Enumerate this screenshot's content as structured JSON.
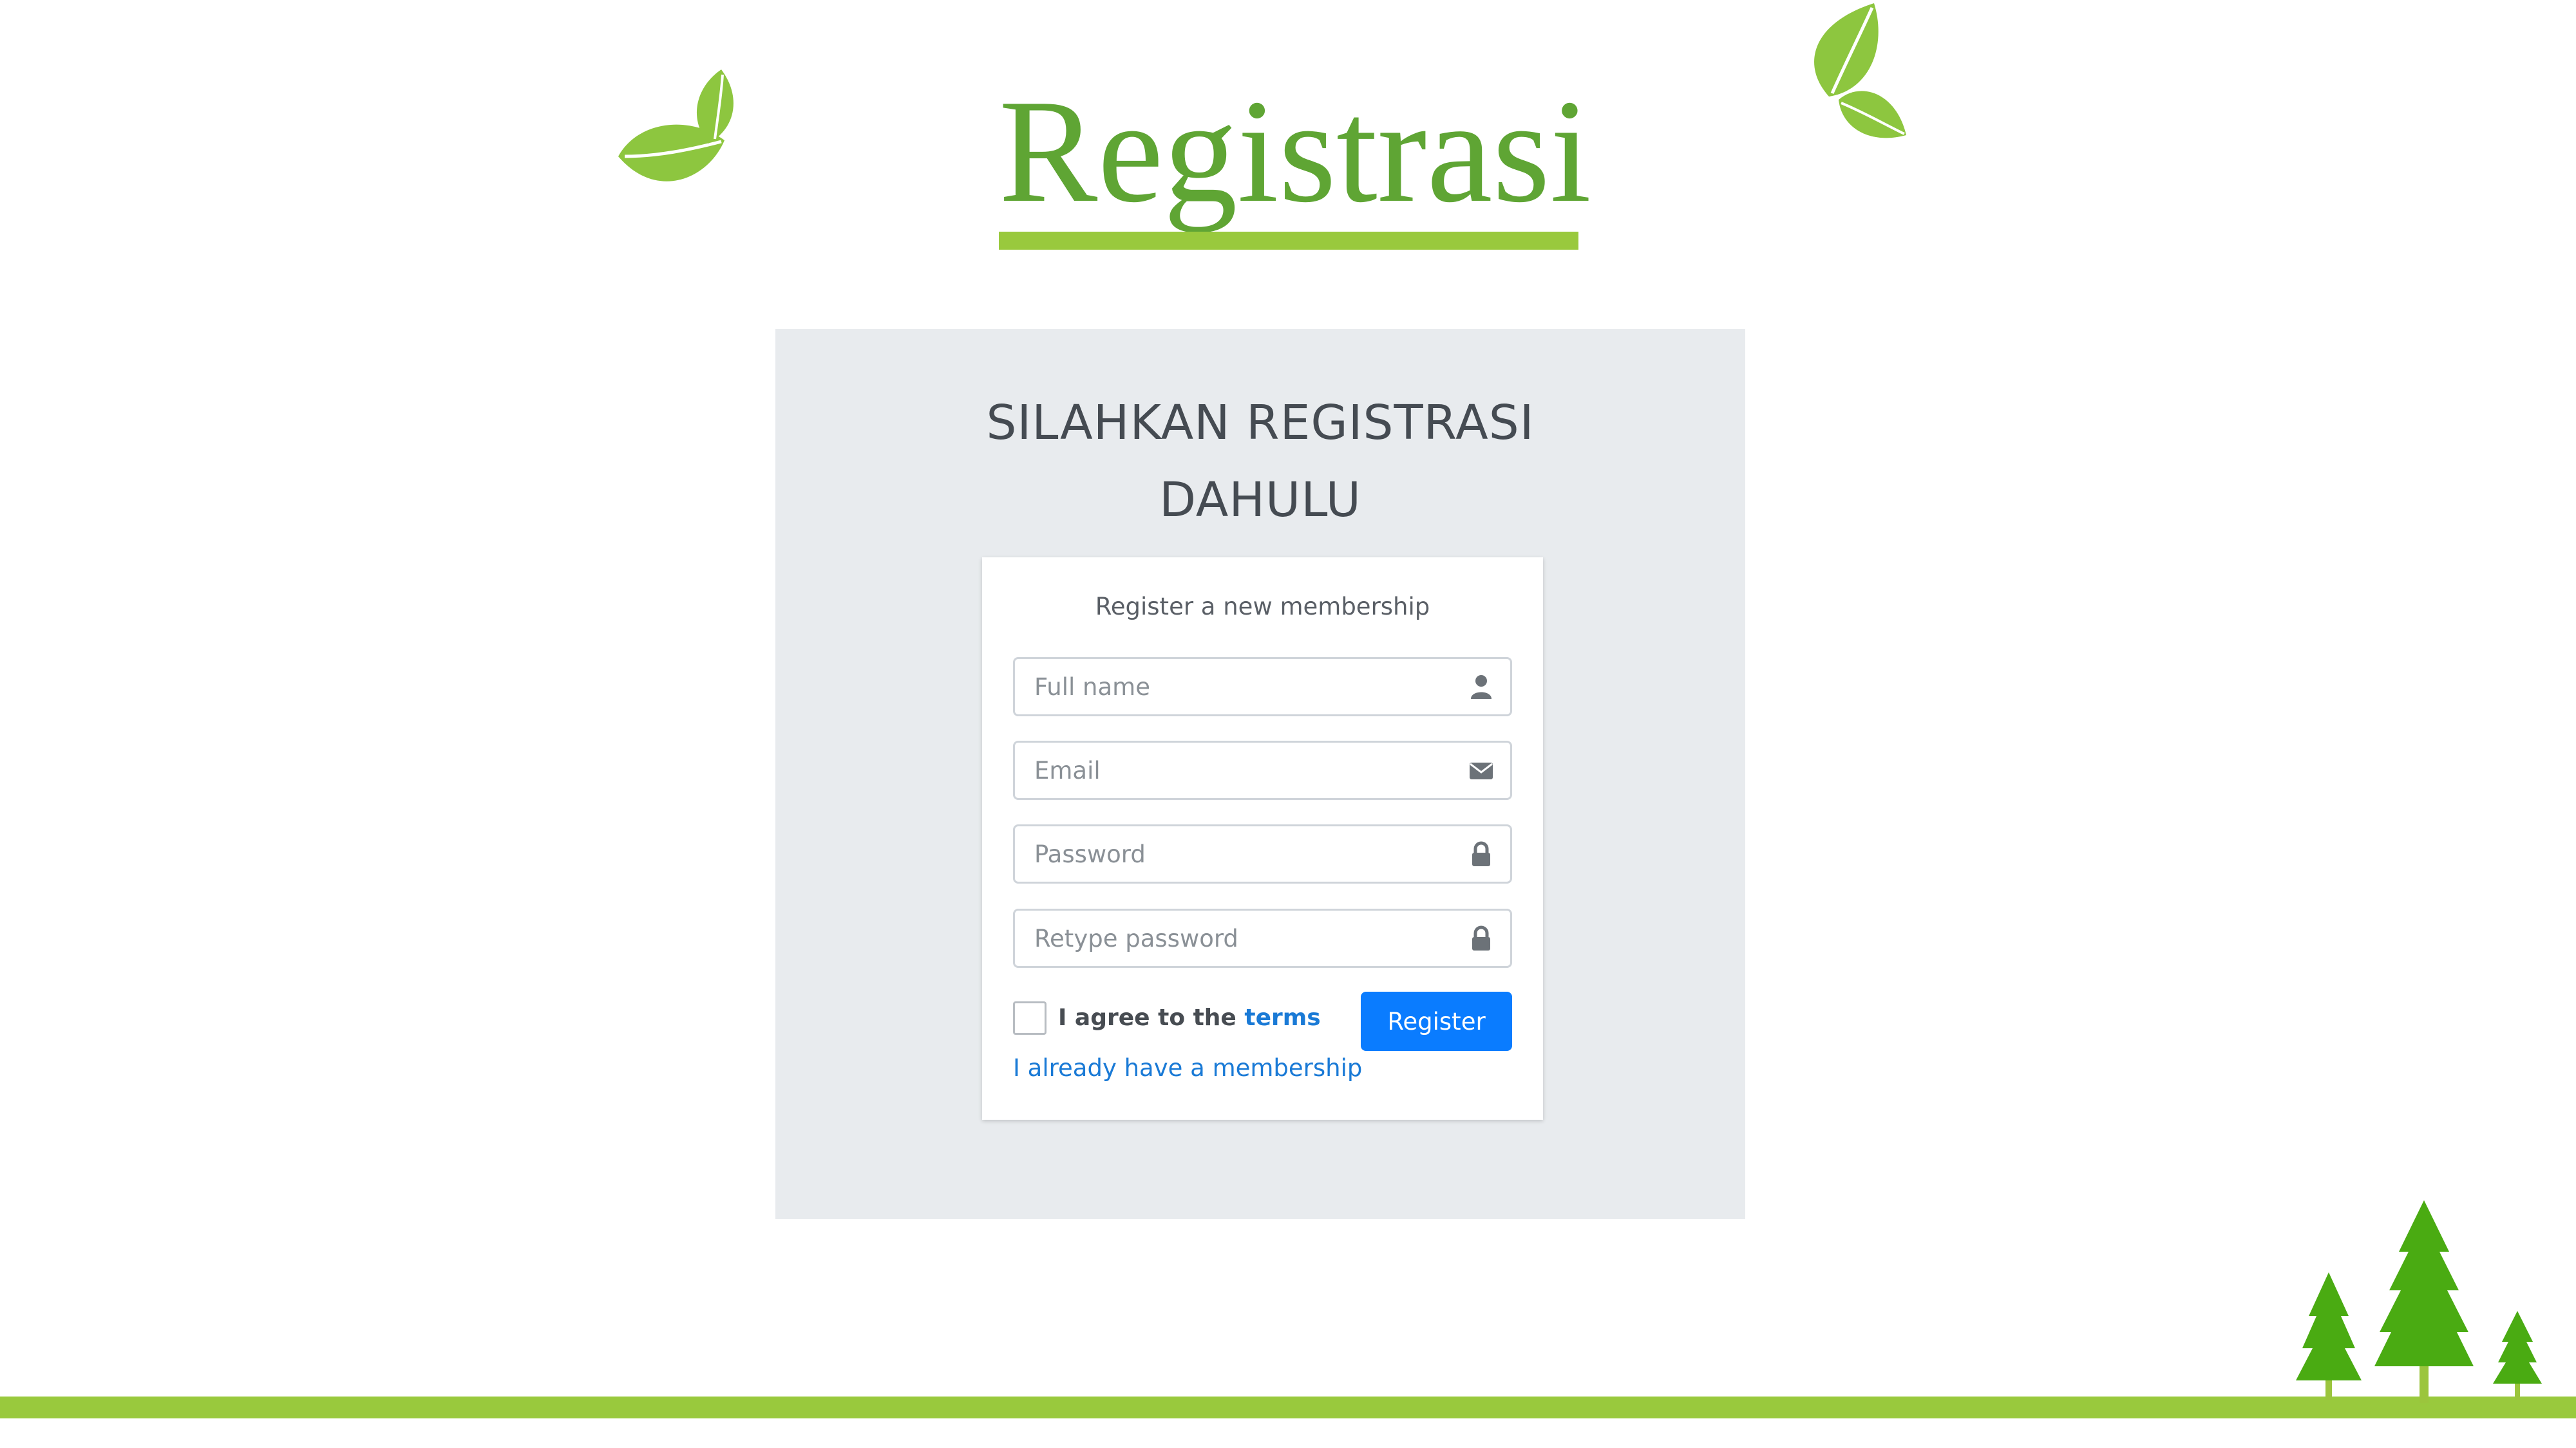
{
  "title": "Registrasi",
  "panel": {
    "heading_line1": "SILAHKAN REGISTRASI",
    "heading_line2": "DAHULU"
  },
  "card": {
    "message": "Register a new membership",
    "fields": {
      "fullname_placeholder": "Full name",
      "email_placeholder": "Email",
      "password_placeholder": "Password",
      "retype_placeholder": "Retype password"
    },
    "agree_prefix": "I agree to the ",
    "agree_terms": "terms",
    "register_label": "Register",
    "member_link": "I already have a membership"
  },
  "icons": {
    "fullname": "user-icon",
    "email": "envelope-icon",
    "password": "lock-icon",
    "retype": "lock-icon"
  },
  "colors": {
    "title": "#5fa534",
    "accent_green": "#99c93d",
    "primary_button": "#0a7cff",
    "link": "#1a7ad6",
    "panel_bg": "#e8ebee"
  }
}
